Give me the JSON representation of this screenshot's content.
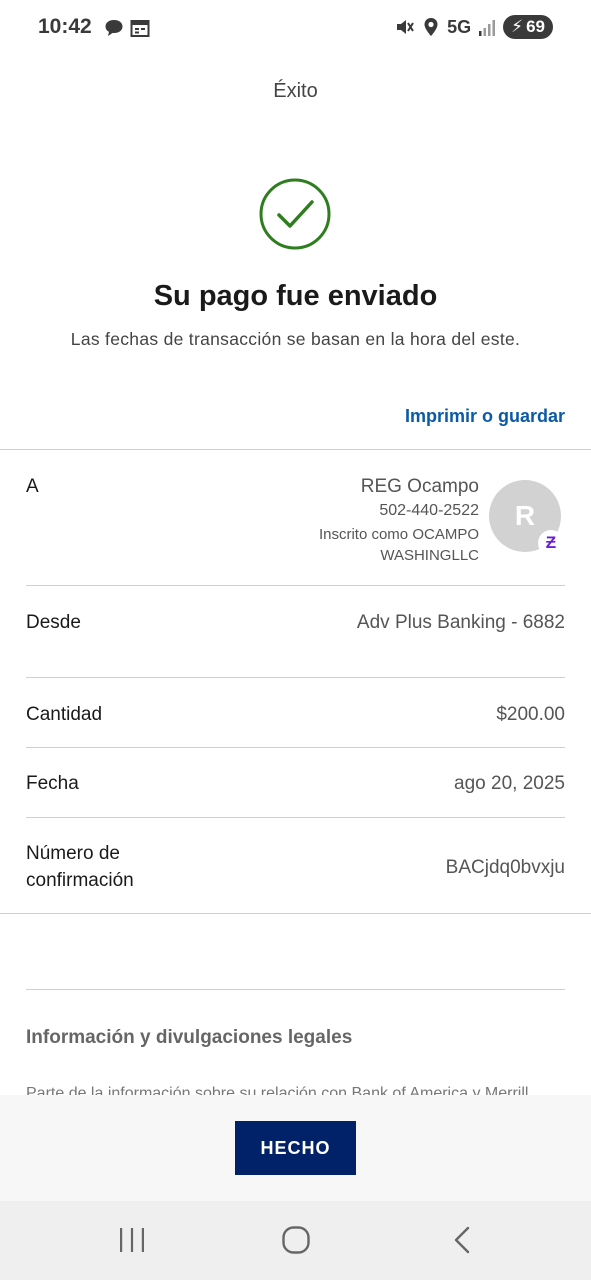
{
  "status_bar": {
    "time": "10:42",
    "network": "5G",
    "battery": "69"
  },
  "header": {
    "title": "Éxito"
  },
  "success": {
    "title": "Su pago fue enviado",
    "subtitle": "Las fechas de transacción se basan en la hora del este.",
    "print_link": "Imprimir o guardar"
  },
  "details": {
    "to": {
      "label": "A",
      "name": "REG Ocampo",
      "phone": "502-440-2522",
      "enrolled_line1": "Inscrito como OCAMPO",
      "enrolled_line2": "WASHINGLLC",
      "avatar_initial": "R",
      "badge_glyph": "Ƶ"
    },
    "from": {
      "label": "Desde",
      "value": "Adv Plus Banking - 6882"
    },
    "amount": {
      "label": "Cantidad",
      "value": "$200.00"
    },
    "date": {
      "label": "Fecha",
      "value": "ago 20, 2025"
    },
    "confirmation": {
      "label_line1": "Número de",
      "label_line2": "confirmación",
      "value": "BACjdq0bvxju"
    }
  },
  "legal": {
    "title": "Información y divulgaciones legales",
    "text": "Parte de la información sobre su relación con Bank of America y Merrill"
  },
  "done_button": {
    "label": "HECHO"
  },
  "colors": {
    "brand_navy": "#012169",
    "link_blue": "#0a5aa8",
    "success_green": "#2e7d1f",
    "zelle_purple": "#6d1ed4"
  },
  "icons": [
    "messages-icon",
    "calendar-icon",
    "mute-icon",
    "location-icon",
    "signal-icon",
    "battery-icon",
    "check-circle-icon",
    "recents-icon",
    "home-icon",
    "back-icon"
  ]
}
